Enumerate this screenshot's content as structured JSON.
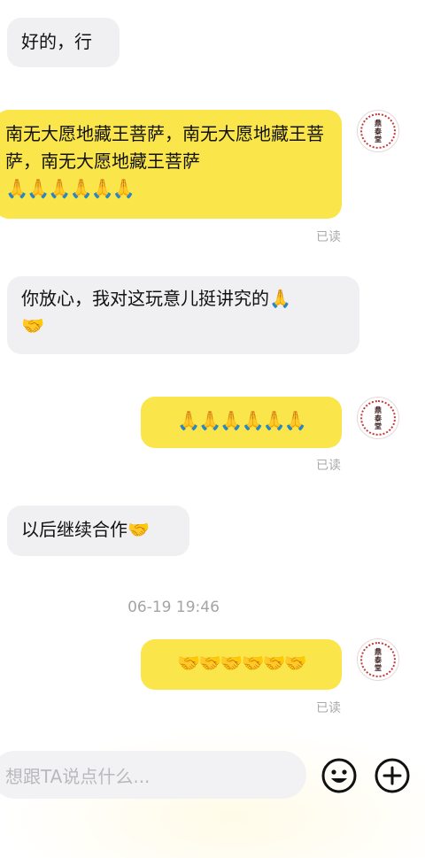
{
  "messages": [
    {
      "text": "好的，行",
      "emoji": ""
    },
    {
      "text": "南无大愿地藏王菩萨，南无大愿地藏王菩萨，南无大愿地藏王菩萨",
      "emoji": "🙏🙏🙏🙏🙏🙏",
      "read": "已读"
    },
    {
      "text": "你放心，我对这玩意儿挺讲究的🙏",
      "emoji": "🤝"
    },
    {
      "text": "",
      "emoji": "🙏🙏🙏🙏🙏🙏",
      "read": "已读"
    },
    {
      "text": "以后继续合作🤝",
      "emoji": ""
    },
    {
      "text": "",
      "emoji": "🤝🤝🤝🤝🤝🤝",
      "read": "已读"
    }
  ],
  "timestamp": "06-19 19:46",
  "avatar": {
    "seal_text": [
      "鼎",
      "泰",
      "堂"
    ]
  },
  "input": {
    "placeholder": "想跟TA说点什么..."
  },
  "icons": {
    "emoji": "smiley-face-icon",
    "plus": "plus-circle-icon"
  }
}
